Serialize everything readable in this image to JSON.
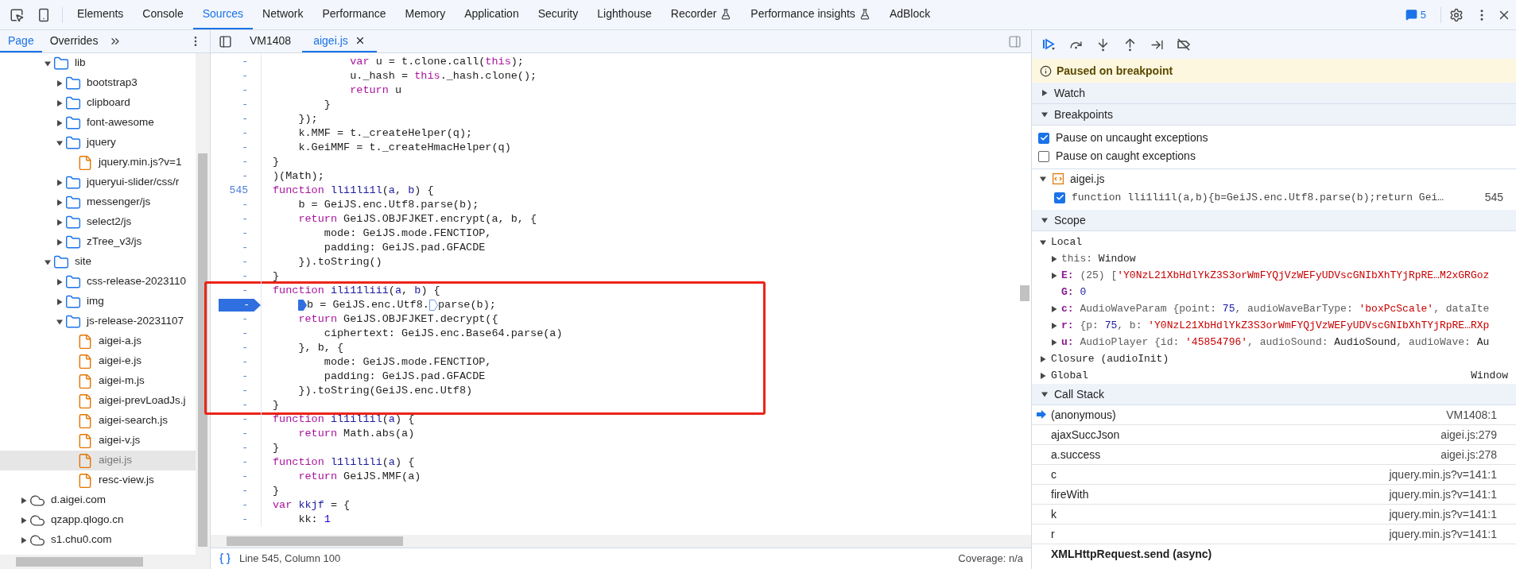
{
  "toolbar": {
    "tabs": [
      {
        "label": "Elements",
        "selected": false,
        "experimental": false
      },
      {
        "label": "Console",
        "selected": false,
        "experimental": false
      },
      {
        "label": "Sources",
        "selected": true,
        "experimental": false
      },
      {
        "label": "Network",
        "selected": false,
        "experimental": false
      },
      {
        "label": "Performance",
        "selected": false,
        "experimental": false
      },
      {
        "label": "Memory",
        "selected": false,
        "experimental": false
      },
      {
        "label": "Application",
        "selected": false,
        "experimental": false
      },
      {
        "label": "Security",
        "selected": false,
        "experimental": false
      },
      {
        "label": "Lighthouse",
        "selected": false,
        "experimental": false
      },
      {
        "label": "Recorder",
        "selected": false,
        "experimental": true
      },
      {
        "label": "Performance insights",
        "selected": false,
        "experimental": true
      },
      {
        "label": "AdBlock",
        "selected": false,
        "experimental": false
      }
    ],
    "issues_count": "5"
  },
  "navigator": {
    "tabs": [
      {
        "label": "Page",
        "selected": true
      },
      {
        "label": "Overrides",
        "selected": false
      }
    ],
    "branch_items": [
      {
        "label": "lib",
        "kind": "folder",
        "expanded": true,
        "selected": false,
        "children": [
          {
            "label": "bootstrap3",
            "kind": "folder",
            "expanded": false,
            "selected": false
          },
          {
            "label": "clipboard",
            "kind": "folder",
            "expanded": false,
            "selected": false
          },
          {
            "label": "font-awesome",
            "kind": "folder",
            "expanded": false,
            "selected": false
          },
          {
            "label": "jquery",
            "kind": "folder",
            "expanded": true,
            "selected": false,
            "children": [
              {
                "label": "jquery.min.js?v=1",
                "kind": "file",
                "selected": false
              }
            ]
          },
          {
            "label": "jqueryui-slider/css/r",
            "kind": "folder",
            "expanded": false,
            "selected": false
          },
          {
            "label": "messenger/js",
            "kind": "folder",
            "expanded": false,
            "selected": false
          },
          {
            "label": "select2/js",
            "kind": "folder",
            "expanded": false,
            "selected": false
          },
          {
            "label": "zTree_v3/js",
            "kind": "folder",
            "expanded": false,
            "selected": false
          }
        ]
      },
      {
        "label": "site",
        "kind": "folder",
        "expanded": true,
        "selected": false,
        "children": [
          {
            "label": "css-release-2023110",
            "kind": "folder",
            "expanded": false,
            "selected": false
          },
          {
            "label": "img",
            "kind": "folder",
            "expanded": false,
            "selected": false
          },
          {
            "label": "js-release-20231107",
            "kind": "folder",
            "expanded": true,
            "selected": false,
            "children": [
              {
                "label": "aigei-a.js",
                "kind": "file",
                "selected": false
              },
              {
                "label": "aigei-e.js",
                "kind": "file",
                "selected": false
              },
              {
                "label": "aigei-m.js",
                "kind": "file",
                "selected": false
              },
              {
                "label": "aigei-prevLoadJs.j",
                "kind": "file",
                "selected": false
              },
              {
                "label": "aigei-search.js",
                "kind": "file",
                "selected": false
              },
              {
                "label": "aigei-v.js",
                "kind": "file",
                "selected": false
              },
              {
                "label": "aigei.js",
                "kind": "file",
                "selected": true
              },
              {
                "label": "resc-view.js",
                "kind": "file",
                "selected": false
              }
            ]
          }
        ]
      }
    ],
    "root_items": [
      {
        "label": "d.aigei.com",
        "kind": "domain",
        "expanded": false,
        "selected": false
      },
      {
        "label": "qzapp.qlogo.cn",
        "kind": "domain",
        "expanded": false,
        "selected": false
      },
      {
        "label": "s1.chu0.com",
        "kind": "domain",
        "expanded": false,
        "selected": false
      }
    ]
  },
  "editor": {
    "tabs": [
      {
        "label": "VM1408",
        "selected": false,
        "closable": false
      },
      {
        "label": "aigei.js",
        "selected": true,
        "closable": true
      }
    ],
    "blocks": [
      {
        "boxed": false,
        "lines": [
          {
            "gutter": "-",
            "paused": false,
            "tokens": [
              {
                "text": "            var",
                "kind": "kw"
              },
              {
                "text": " u = t.clone.call(",
                "kind": "plain"
              },
              {
                "text": "this",
                "kind": "kw"
              },
              {
                "text": ");",
                "kind": "plain"
              }
            ]
          },
          {
            "gutter": "-",
            "paused": false,
            "tokens": [
              {
                "text": "            u._hash = ",
                "kind": "plain"
              },
              {
                "text": "this",
                "kind": "kw"
              },
              {
                "text": "._hash.clone();",
                "kind": "plain"
              }
            ]
          },
          {
            "gutter": "-",
            "paused": false,
            "tokens": [
              {
                "text": "            return",
                "kind": "kw"
              },
              {
                "text": " u",
                "kind": "plain"
              }
            ]
          },
          {
            "gutter": "-",
            "paused": false,
            "tokens": [
              {
                "text": "        }",
                "kind": "plain"
              }
            ]
          },
          {
            "gutter": "-",
            "paused": false,
            "tokens": [
              {
                "text": "    });",
                "kind": "plain"
              }
            ]
          },
          {
            "gutter": "-",
            "paused": false,
            "tokens": [
              {
                "text": "    k.MMF = t._createHelper(q);",
                "kind": "plain"
              }
            ]
          },
          {
            "gutter": "-",
            "paused": false,
            "tokens": [
              {
                "text": "    k.GeiMMF = t._createHmacHelper(q)",
                "kind": "plain"
              }
            ]
          },
          {
            "gutter": "-",
            "paused": false,
            "tokens": [
              {
                "text": "}",
                "kind": "plain"
              }
            ]
          },
          {
            "gutter": "-",
            "paused": false,
            "tokens": [
              {
                "text": ")(Math);",
                "kind": "plain"
              }
            ]
          },
          {
            "gutter": "545",
            "paused": false,
            "tokens": [
              {
                "text": "function ",
                "kind": "kw"
              },
              {
                "text": "lli1li1l",
                "kind": "def"
              },
              {
                "text": "(",
                "kind": "plain"
              },
              {
                "text": "a",
                "kind": "def"
              },
              {
                "text": ", ",
                "kind": "plain"
              },
              {
                "text": "b",
                "kind": "def"
              },
              {
                "text": ") {",
                "kind": "plain"
              }
            ]
          },
          {
            "gutter": "-",
            "paused": false,
            "tokens": [
              {
                "text": "    b = GeiJS.enc.Utf8.parse(b);",
                "kind": "plain"
              }
            ]
          },
          {
            "gutter": "-",
            "paused": false,
            "tokens": [
              {
                "text": "    return",
                "kind": "kw"
              },
              {
                "text": " GeiJS.OBJFJKET.encrypt(a, b, {",
                "kind": "plain"
              }
            ]
          },
          {
            "gutter": "-",
            "paused": false,
            "tokens": [
              {
                "text": "        mode: GeiJS.mode.FENCTIOP,",
                "kind": "plain"
              }
            ]
          },
          {
            "gutter": "-",
            "paused": false,
            "tokens": [
              {
                "text": "        padding: GeiJS.pad.GFACDE",
                "kind": "plain"
              }
            ]
          },
          {
            "gutter": "-",
            "paused": false,
            "tokens": [
              {
                "text": "    }).toString()",
                "kind": "plain"
              }
            ]
          },
          {
            "gutter": "-",
            "paused": false,
            "tokens": [
              {
                "text": "}",
                "kind": "plain"
              }
            ]
          }
        ]
      },
      {
        "boxed": true,
        "lines": [
          {
            "gutter": "-",
            "paused": false,
            "tokens": [
              {
                "text": "function ",
                "kind": "kw"
              },
              {
                "text": "ili11liii",
                "kind": "def"
              },
              {
                "text": "(",
                "kind": "plain"
              },
              {
                "text": "a",
                "kind": "def"
              },
              {
                "text": ", ",
                "kind": "plain"
              },
              {
                "text": "b",
                "kind": "def"
              },
              {
                "text": ") {",
                "kind": "plain"
              }
            ]
          },
          {
            "gutter": "-",
            "paused": true,
            "tokens": [
              {
                "kind": "marker",
                "active": true
              },
              {
                "text": "b = GeiJS.enc.Utf8.",
                "kind": "plain"
              },
              {
                "kind": "marker",
                "active": false
              },
              {
                "text": "parse(b);",
                "kind": "plain"
              }
            ]
          },
          {
            "gutter": "-",
            "paused": false,
            "tokens": [
              {
                "text": "    return",
                "kind": "kw"
              },
              {
                "text": " GeiJS.OBJFJKET.decrypt({",
                "kind": "plain"
              }
            ]
          },
          {
            "gutter": "-",
            "paused": false,
            "tokens": [
              {
                "text": "        ciphertext: GeiJS.enc.Base64.parse(a)",
                "kind": "plain"
              }
            ]
          },
          {
            "gutter": "-",
            "paused": false,
            "tokens": [
              {
                "text": "    }, b, {",
                "kind": "plain"
              }
            ]
          },
          {
            "gutter": "-",
            "paused": false,
            "tokens": [
              {
                "text": "        mode: GeiJS.mode.FENCTIOP,",
                "kind": "plain"
              }
            ]
          },
          {
            "gutter": "-",
            "paused": false,
            "tokens": [
              {
                "text": "        padding: GeiJS.pad.GFACDE",
                "kind": "plain"
              }
            ]
          },
          {
            "gutter": "-",
            "paused": false,
            "tokens": [
              {
                "text": "    }).toString(GeiJS.enc.Utf8)",
                "kind": "plain"
              }
            ]
          },
          {
            "gutter": "-",
            "paused": false,
            "tokens": [
              {
                "text": "}",
                "kind": "plain"
              }
            ]
          }
        ]
      },
      {
        "boxed": false,
        "lines": [
          {
            "gutter": "-",
            "paused": false,
            "tokens": [
              {
                "text": "function ",
                "kind": "kw"
              },
              {
                "text": "il1il1il",
                "kind": "def"
              },
              {
                "text": "(",
                "kind": "plain"
              },
              {
                "text": "a",
                "kind": "def"
              },
              {
                "text": ") {",
                "kind": "plain"
              }
            ]
          },
          {
            "gutter": "-",
            "paused": false,
            "tokens": [
              {
                "text": "    return",
                "kind": "kw"
              },
              {
                "text": " Math.abs(a)",
                "kind": "plain"
              }
            ]
          },
          {
            "gutter": "-",
            "paused": false,
            "tokens": [
              {
                "text": "}",
                "kind": "plain"
              }
            ]
          },
          {
            "gutter": "-",
            "paused": false,
            "tokens": [
              {
                "text": "function ",
                "kind": "kw"
              },
              {
                "text": "l1lilili",
                "kind": "def"
              },
              {
                "text": "(",
                "kind": "plain"
              },
              {
                "text": "a",
                "kind": "def"
              },
              {
                "text": ") {",
                "kind": "plain"
              }
            ]
          },
          {
            "gutter": "-",
            "paused": false,
            "tokens": [
              {
                "text": "    return",
                "kind": "kw"
              },
              {
                "text": " GeiJS.MMF(a)",
                "kind": "plain"
              }
            ]
          },
          {
            "gutter": "-",
            "paused": false,
            "tokens": [
              {
                "text": "}",
                "kind": "plain"
              }
            ]
          },
          {
            "gutter": "-",
            "paused": false,
            "tokens": [
              {
                "text": "var ",
                "kind": "kw"
              },
              {
                "text": "kkjf",
                "kind": "def"
              },
              {
                "text": " = {",
                "kind": "plain"
              }
            ]
          },
          {
            "gutter": "-",
            "paused": false,
            "tokens": [
              {
                "text": "    kk: ",
                "kind": "plain"
              },
              {
                "text": "1",
                "kind": "num"
              }
            ]
          }
        ]
      }
    ],
    "status": {
      "position": "Line 545, Column 100",
      "coverage": "Coverage: n/a"
    }
  },
  "debugger": {
    "paused_message": "Paused on breakpoint",
    "watch": {
      "title": "Watch",
      "expanded": false
    },
    "breakpoints": {
      "title": "Breakpoints",
      "expanded": true,
      "options": [
        {
          "label": "Pause on uncaught exceptions",
          "checked": true
        },
        {
          "label": "Pause on caught exceptions",
          "checked": false
        }
      ],
      "files": [
        {
          "name": "aigei.js",
          "expanded": true,
          "items": [
            {
              "code": "function lli1li1l(a,b){b=GeiJS.enc.Utf8.parse(b);return Gei…",
              "line": "545",
              "checked": true
            }
          ]
        }
      ]
    },
    "scope": {
      "title": "Scope",
      "expanded": true,
      "groups": [
        {
          "title": "Local",
          "expanded": true,
          "vars": [
            {
              "name": "this:",
              "own": false,
              "expandable": true,
              "value": [
                {
                  "text": "Window",
                  "kind": "obj"
                }
              ]
            },
            {
              "name": "E:",
              "own": true,
              "expandable": true,
              "value": [
                {
                  "text": "(25) [",
                  "kind": "plain"
                },
                {
                  "text": "'Y0NzL21XbHdlYkZ3S3orWmFYQjVzWEFyUDVscGNIbXhTYjRpRE…M2xGRGoz",
                  "kind": "str"
                }
              ]
            },
            {
              "name": "G:",
              "own": true,
              "expandable": false,
              "value": [
                {
                  "text": "0",
                  "kind": "num"
                }
              ]
            },
            {
              "name": "c:",
              "own": true,
              "expandable": true,
              "value": [
                {
                  "text": "AudioWaveParam {point: ",
                  "kind": "plain"
                },
                {
                  "text": "75",
                  "kind": "num"
                },
                {
                  "text": ", audioWaveBarType: ",
                  "kind": "plain"
                },
                {
                  "text": "'boxPcScale'",
                  "kind": "str"
                },
                {
                  "text": ", dataIte",
                  "kind": "plain"
                }
              ]
            },
            {
              "name": "r:",
              "own": true,
              "expandable": true,
              "value": [
                {
                  "text": "{p: ",
                  "kind": "plain"
                },
                {
                  "text": "75",
                  "kind": "num"
                },
                {
                  "text": ", b: ",
                  "kind": "plain"
                },
                {
                  "text": "'Y0NzL21XbHdlYkZ3S3orWmFYQjVzWEFyUDVscGNIbXhTYjRpRE…RXp",
                  "kind": "str"
                }
              ]
            },
            {
              "name": "u:",
              "own": true,
              "expandable": true,
              "value": [
                {
                  "text": "AudioPlayer {id: ",
                  "kind": "plain"
                },
                {
                  "text": "'45854796'",
                  "kind": "str"
                },
                {
                  "text": ", audioSound: ",
                  "kind": "plain"
                },
                {
                  "text": "AudioSound",
                  "kind": "obj"
                },
                {
                  "text": ", audioWave: ",
                  "kind": "plain"
                },
                {
                  "text": "Au",
                  "kind": "obj"
                }
              ]
            }
          ]
        },
        {
          "title": "Closure (audioInit)",
          "expanded": false
        },
        {
          "title": "Global",
          "expanded": false,
          "value": "Window"
        }
      ]
    },
    "call_stack": {
      "title": "Call Stack",
      "expanded": true,
      "frames": [
        {
          "name": "(anonymous)",
          "location": "VM1408:1",
          "selected": true
        },
        {
          "name": "ajaxSuccJson",
          "location": "aigei.js:279",
          "selected": false
        },
        {
          "name": "a.success",
          "location": "aigei.js:278",
          "selected": false
        },
        {
          "name": "c",
          "location": "jquery.min.js?v=141:1",
          "selected": false
        },
        {
          "name": "fireWith",
          "location": "jquery.min.js?v=141:1",
          "selected": false
        },
        {
          "name": "k",
          "location": "jquery.min.js?v=141:1",
          "selected": false
        },
        {
          "name": "r",
          "location": "jquery.min.js?v=141:1",
          "selected": false
        }
      ],
      "async_label": "XMLHttpRequest.send (async)"
    }
  }
}
